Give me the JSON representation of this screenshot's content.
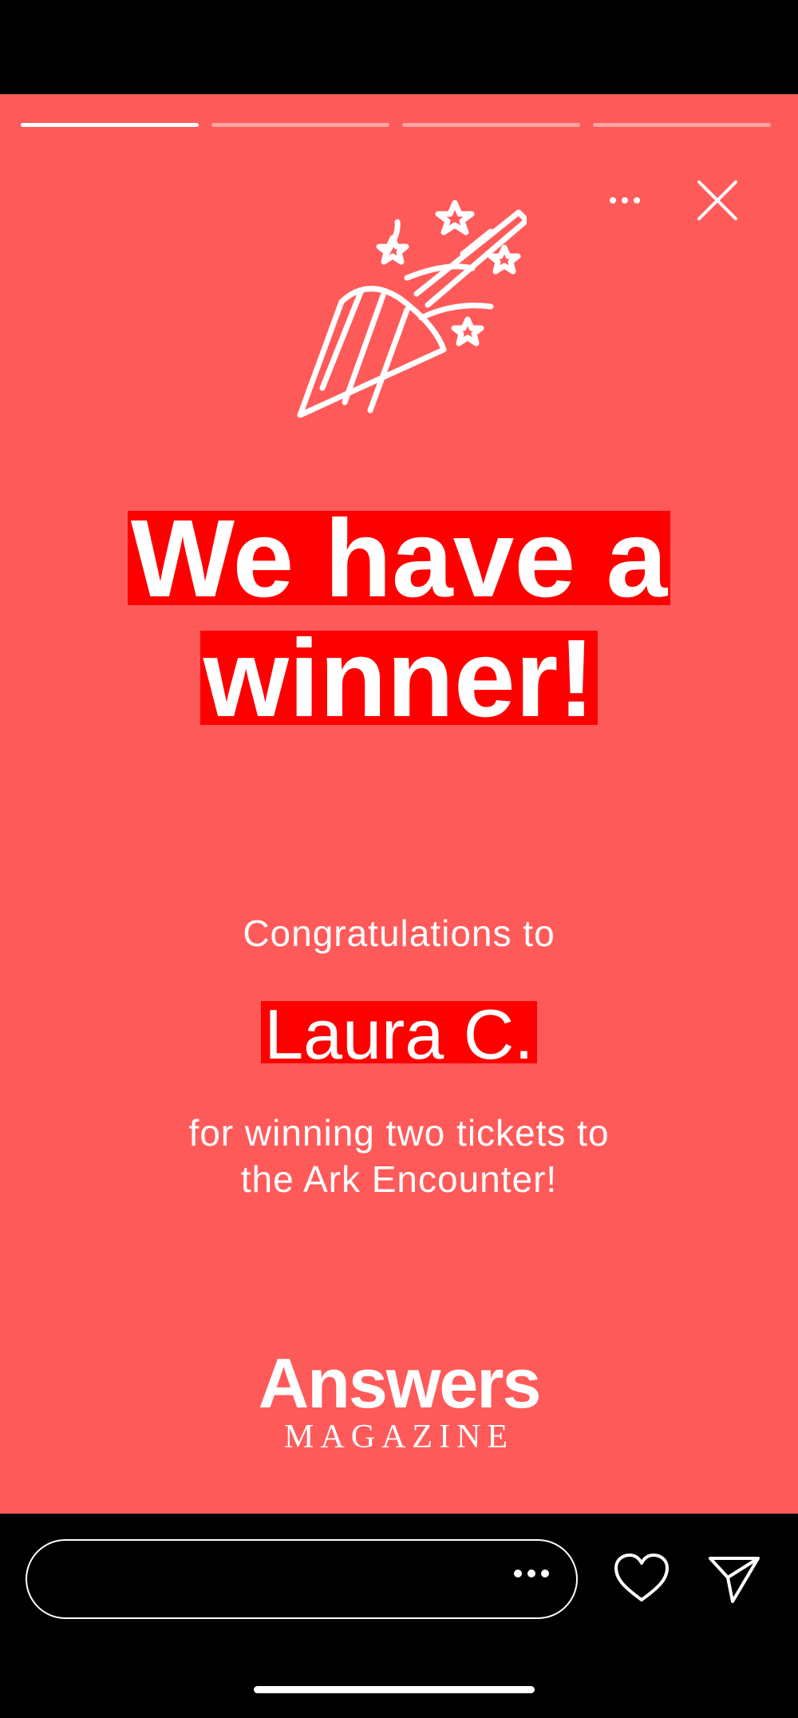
{
  "story": {
    "background_color": "#ff5a5a",
    "highlight_color": "#ff0000",
    "progress": {
      "total_segments": 4,
      "current_segment": 1
    },
    "icons": {
      "more": "more-dots-icon",
      "close": "close-icon",
      "hero": "party-popper-icon"
    },
    "headline": {
      "line1": "We have a",
      "line2": "winner!"
    },
    "congrats": "Congratulations to",
    "winner_name": "Laura C.",
    "description": {
      "line1": "for winning two tickets to",
      "line2": "the Ark Encounter!"
    },
    "brand": {
      "name": "Answers",
      "subtitle": "MAGAZINE"
    }
  },
  "footer": {
    "reply_placeholder": "",
    "icons": {
      "reply_more": "more-dots-icon",
      "like": "heart-icon",
      "share": "send-icon"
    }
  }
}
